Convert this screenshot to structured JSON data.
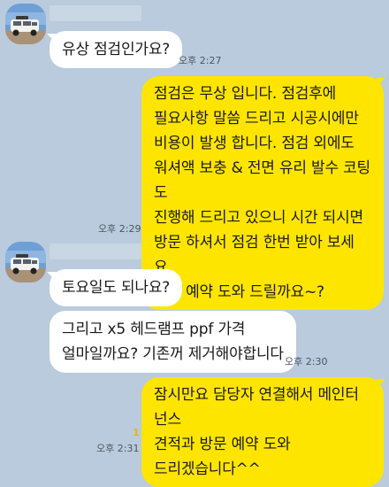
{
  "messages": {
    "m1": {
      "text": "유상 점검인가요?",
      "time": "오후 2:27"
    },
    "m2": {
      "text": "점검은 무상 입니다. 점검후에\n필요사항 말씀 드리고 시공시에만\n비용이 발생 합니다. 점검 외에도\n워셔액 보충 & 전면 유리 발수 코팅도\n진행해 드리고 있으니 시간 되시면\n방문 하셔서 점검 한번 받아 보세요.\n방문 예약 도와 드릴까요~?",
      "time": "오후 2:29"
    },
    "m3": {
      "text": "토요일도 되나요?"
    },
    "m4": {
      "text": "그리고 x5 헤드램프 ppf 가격\n얼마일까요? 기존꺼 제거해야합니다",
      "time": "오후 2:30"
    },
    "m5": {
      "text": "잠시만요 담당자 연결해서 메인터넌스\n견적과 방문 예약 도와\n드리겠습니다^^",
      "time": "오후 2:31",
      "unread": "1"
    }
  },
  "colors": {
    "background": "#b9cbdd",
    "incoming_bubble": "#ffffff",
    "outgoing_bubble": "#fee500"
  },
  "icons": {
    "avatar": "avatar-car-photo-icon"
  }
}
